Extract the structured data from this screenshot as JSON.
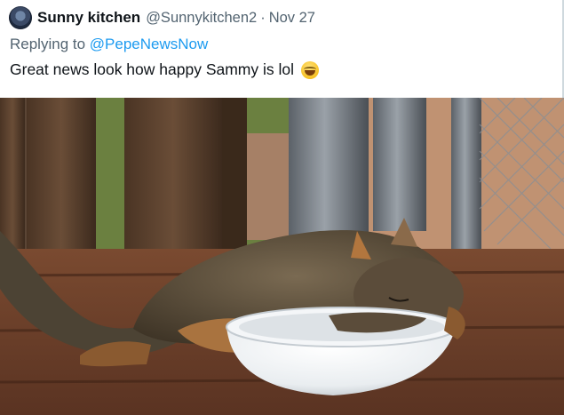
{
  "tweet": {
    "display_name": "Sunny kitchen",
    "handle": "@Sunnykitchen2",
    "separator": "·",
    "date": "Nov 27",
    "reply_prefix": "Replying to ",
    "reply_to": "@PepeNewsNow",
    "text": "Great news look how happy Sammy is lol",
    "emoji": "grinning-squinting-face-emoji"
  },
  "photo": {
    "subject": "squirrel-sleeping-on-bowl-photo"
  }
}
